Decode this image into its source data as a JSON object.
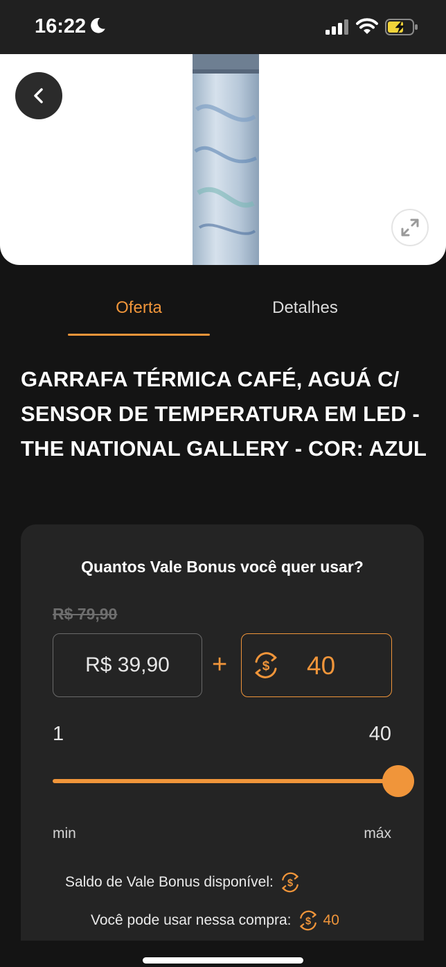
{
  "status_bar": {
    "time": "16:22",
    "icons": [
      "moon-icon",
      "cellular-signal-icon",
      "wifi-icon",
      "battery-charging-icon"
    ]
  },
  "hero": {
    "image_alt": "thermal bottle product photo",
    "icons": [
      "back-chevron-icon",
      "expand-icon"
    ]
  },
  "tabs": [
    {
      "label": "Oferta",
      "active": true
    },
    {
      "label": "Detalhes",
      "active": false
    }
  ],
  "product": {
    "title": "GARRAFA TÉRMICA CAFÉ, AGUÁ C/ SENSOR DE TEMPERATURA EM LED - THE NATIONAL GALLERY - COR: AZUL"
  },
  "bonus_card": {
    "question": "Quantos Vale Bonus você quer usar?",
    "old_price": "R$ 79,90",
    "price": "R$ 39,90",
    "plus": "+",
    "bonus_amount": "40",
    "range_min": "1",
    "range_max": "40",
    "slider_value_fraction": 1.0,
    "label_min": "min",
    "label_max": "máx",
    "balance_label": "Saldo de Vale Bonus disponível:",
    "usable_label": "Você pode usar nessa compra:",
    "usable_value": "40"
  },
  "colors": {
    "accent": "#f0953a",
    "background": "#141414",
    "card": "#242424",
    "status_bar": "#202020"
  }
}
